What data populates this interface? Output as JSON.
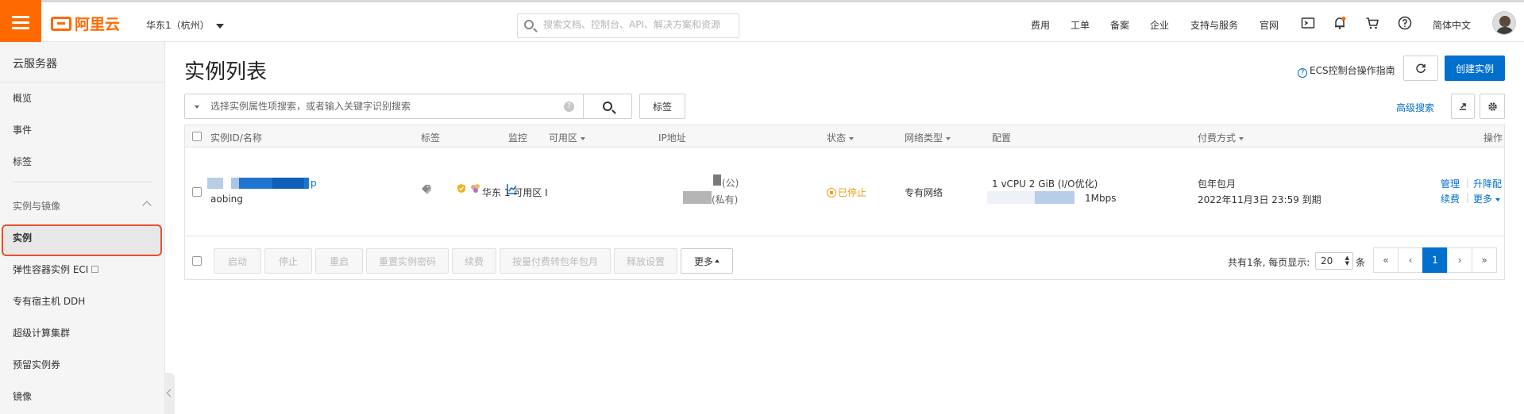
{
  "header": {
    "logo_text": "阿里云",
    "region": "华东1（杭州）",
    "search_placeholder": "搜索文档、控制台、API、解决方案和资源",
    "nav": [
      "费用",
      "工单",
      "备案",
      "企业",
      "支持与服务",
      "官网"
    ],
    "language": "简体中文"
  },
  "sidebar": {
    "title": "云服务器",
    "items_top": [
      "概览",
      "事件",
      "标签"
    ],
    "section": "实例与镜像",
    "items": [
      "实例",
      "弹性容器实例 ECI",
      "专有宿主机 DDH",
      "超级计算集群",
      "预留实例券",
      "镜像"
    ]
  },
  "main": {
    "title": "实例列表",
    "guide_link": "ECS控制台操作指南",
    "create_button": "创建实例",
    "filter_placeholder": "选择实例属性项搜索，或者输入关键字识别搜索",
    "tag_button": "标签",
    "advanced_search": "高级搜索"
  },
  "table": {
    "headers": {
      "id": "实例ID/名称",
      "tags": "标签",
      "monitor": "监控",
      "zone": "可用区",
      "ip": "IP地址",
      "status": "状态",
      "network": "网络类型",
      "config": "配置",
      "billing": "付费方式",
      "actions": "操作"
    },
    "row": {
      "id_suffix": "p",
      "name": "aobing",
      "zone": "华东 1 可用区 I",
      "ip_public_suffix": "(公)",
      "ip_private_suffix": "(私有)",
      "status": "已停止",
      "network": "专有网络",
      "config_line1": "1 vCPU 2 GiB (I/O优化)",
      "config_line2": "1Mbps",
      "billing_line1": "包年包月",
      "billing_line2": "2022年11月3日 23:59 到期",
      "action_manage": "管理",
      "action_upgrade": "升降配",
      "action_renew": "续费",
      "action_more": "更多"
    },
    "footer_buttons": [
      "启动",
      "停止",
      "重启",
      "重置实例密码",
      "续费",
      "按量付费转包年包月",
      "释放设置"
    ],
    "more_button": "更多",
    "pager_text": "共有1条, 每页显示:",
    "page_size": "20",
    "page_size_unit": "条",
    "current_page": "1"
  },
  "colors": {
    "brand": "#ff6a00",
    "primary": "#0070cc",
    "status_stopped": "#f39c12"
  }
}
